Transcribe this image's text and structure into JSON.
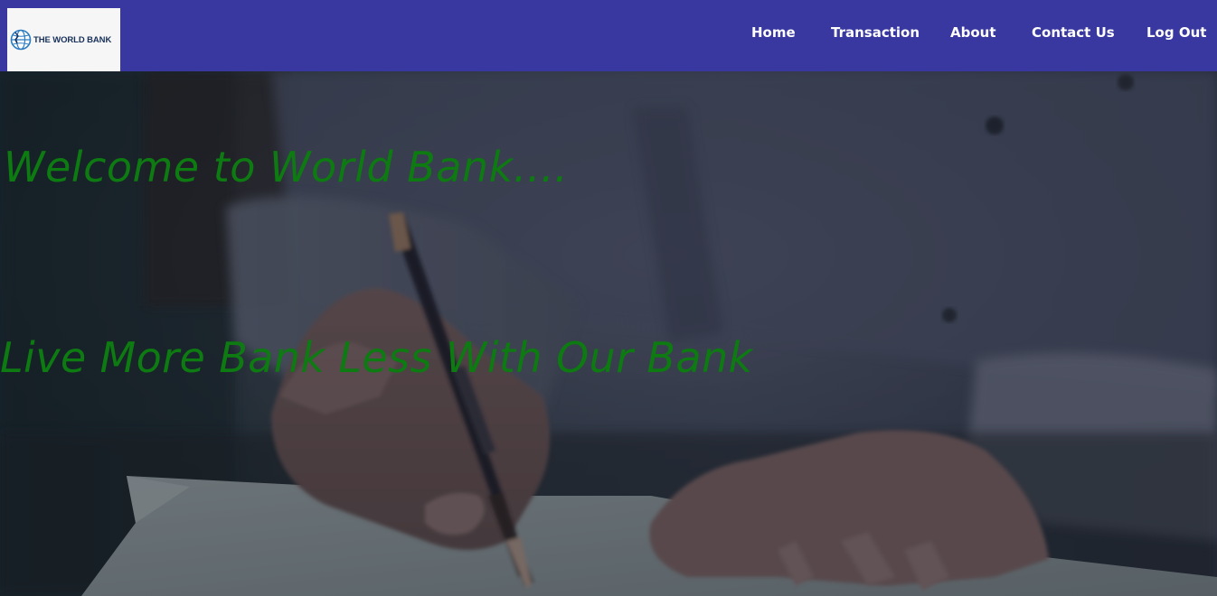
{
  "header": {
    "logo_text": "THE WORLD BANK",
    "logo_icon": "globe-icon",
    "nav": [
      {
        "label": "Home"
      },
      {
        "label": "Transaction"
      },
      {
        "label": "About"
      },
      {
        "label": "Contact Us"
      },
      {
        "label": "Log Out"
      }
    ],
    "bg_color": "#3838a0"
  },
  "hero": {
    "welcome": "Welcome to World Bank....",
    "tagline": "Live More Bank Less With Our Bank",
    "text_color": "#0d7a12",
    "background_image": "person-writing-with-pen-photo"
  }
}
